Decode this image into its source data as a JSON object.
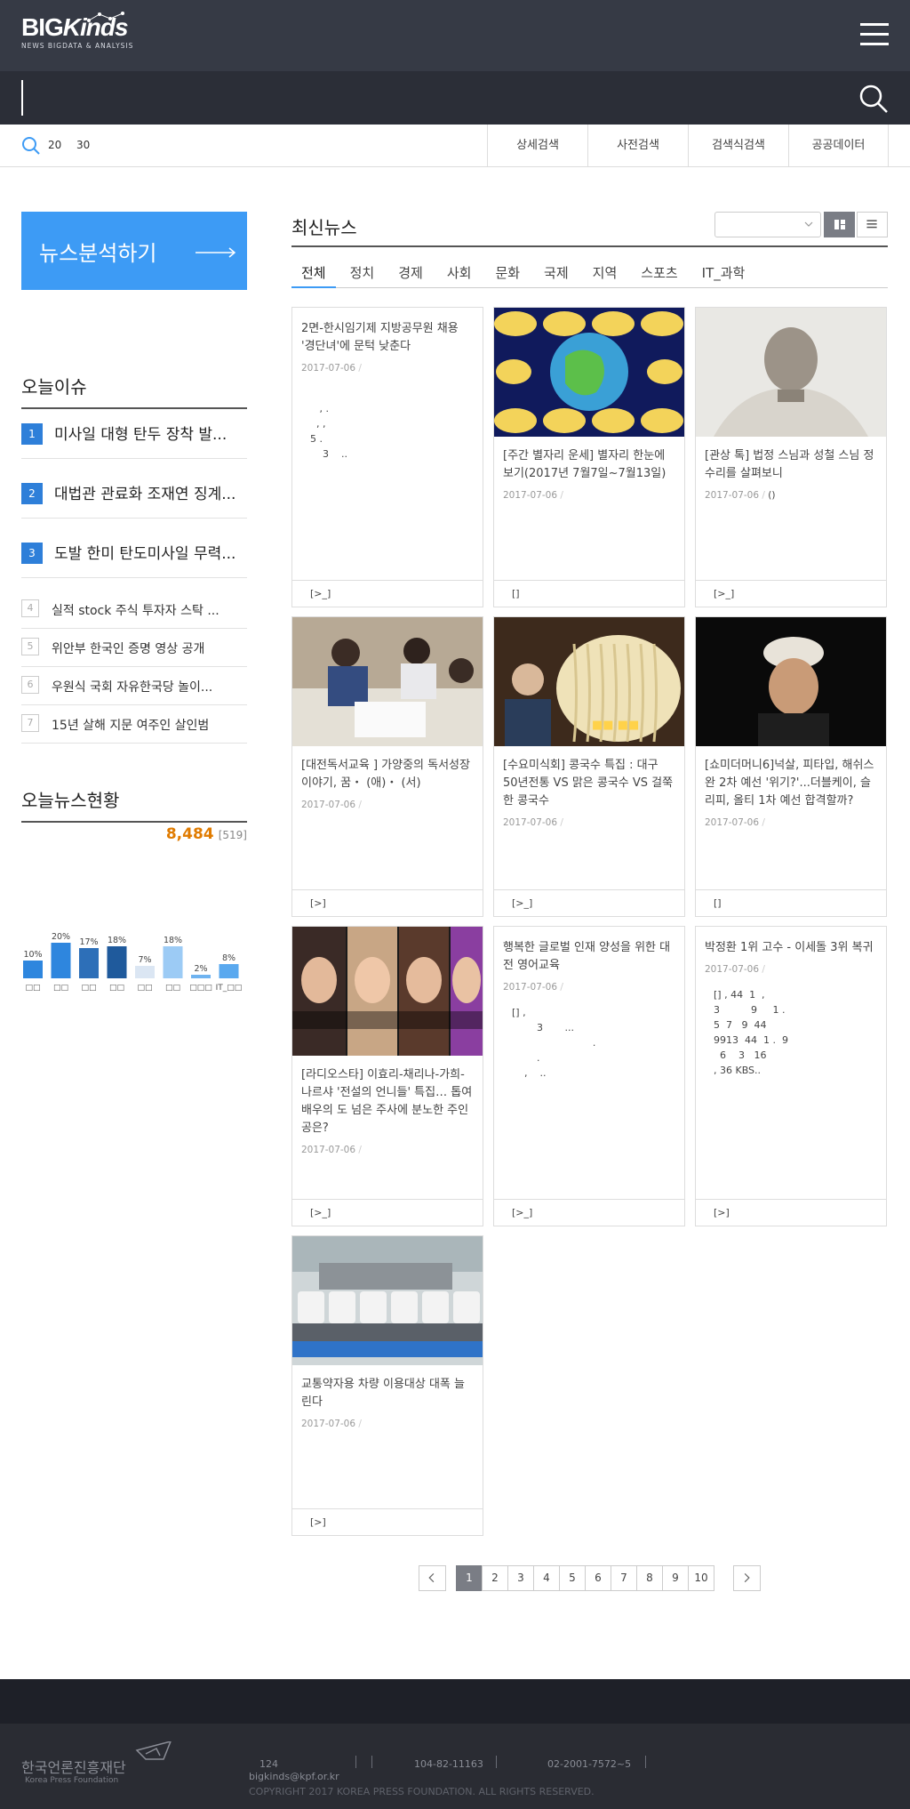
{
  "header": {
    "logo_big": "BIG",
    "logo_italic": "Kinds",
    "logo_sub": "NEWS BIGDATA & ANALYSIS",
    "menu_icon": "hamburger-icon"
  },
  "search": {
    "value": "",
    "placeholder": "",
    "icon": "search-icon"
  },
  "subnav": {
    "keyword1": "20",
    "keyword2": "30",
    "links": [
      "상세검색",
      "사전검색",
      "검색식검색",
      "공공데이터"
    ]
  },
  "sidebar": {
    "analyze_label": "뉴스분석하기",
    "issues_title": "오늘이슈",
    "issues_top": [
      {
        "num": "1",
        "text": "미사일 대형 탄두 장착 발..."
      },
      {
        "num": "2",
        "text": "대법관 관료화 조재연 징계..."
      },
      {
        "num": "3",
        "text": "도발 한미 탄도미사일 무력..."
      }
    ],
    "issues_rest": [
      {
        "num": "4",
        "text": "실적 stock 주식 투자자 스탁 ..."
      },
      {
        "num": "5",
        "text": "위안부 한국인 증명 영상 공개"
      },
      {
        "num": "6",
        "text": "우원식 국회 자유한국당 놀이..."
      },
      {
        "num": "7",
        "text": "15년 살해 지문 여주인 살인범"
      }
    ],
    "status_title": "오늘뉴스현황",
    "count_main": "8,484",
    "count_sub": "[519]"
  },
  "chart_data": {
    "type": "bar",
    "categories": [
      "",
      "",
      "",
      "",
      "",
      "",
      "",
      "IT_"
    ],
    "category_labels_shown": [
      "□□",
      "□□",
      "□□",
      "□□",
      "□□",
      "□□",
      "□□□",
      "IT_□□"
    ],
    "values": [
      10,
      20,
      17,
      18,
      7,
      18,
      2,
      8
    ],
    "value_labels": [
      "10%",
      "20%",
      "17%",
      "18%",
      "7%",
      "18%",
      "2%",
      "8%"
    ],
    "colors": [
      "#2e86de",
      "#2e86de",
      "#2d6fb8",
      "#1f5a9c",
      "#dbe6f3",
      "#9ccbf5",
      "#6fb3f0",
      "#5aa9ef"
    ],
    "ylim": [
      0,
      20
    ]
  },
  "news": {
    "title": "최신뉴스",
    "sort_value": "",
    "grid_icon": "grid-view-icon",
    "list_icon": "list-view-icon",
    "categories": [
      "전체",
      "정치",
      "경제",
      "사회",
      "문화",
      "국제",
      "지역",
      "스포츠",
      "IT_과학"
    ],
    "cards": [
      {
        "title": "2면-한시임기제 지방공무원 채용 '경단녀'에 문턱 낮춘다",
        "date": "2017-07-06",
        "body": "\n   , .\n  , ,\n5 .\n    3    ..",
        "foot": "[>_]",
        "img": ""
      },
      {
        "title": "[주간 별자리 운세] 별자리 한눈에 보기(2017년 7월7일~7월13일)",
        "date": "2017-07-06",
        "body": "",
        "foot": "[]",
        "img": "zodiac"
      },
      {
        "title": "[관상 톡] 법정 스님과 성철 스님 정수리를 살펴보니",
        "date": "2017-07-06",
        "body": "",
        "date_extra": "()",
        "foot": "[>_]",
        "img": "monk"
      },
      {
        "title": "[대전독서교육 ] 가양중의 독서성장 이야기, 꿈・ (애)・ (서)",
        "date": "2017-07-06",
        "body": "",
        "foot": "[>]",
        "img": "class"
      },
      {
        "title": "[수요미식회] 콩국수 특집 : 대구 50년전통 VS 맑은 콩국수 VS 걸쭉한 콩국수",
        "date": "2017-07-06",
        "body": "",
        "foot": "[>_]",
        "img": "noodle"
      },
      {
        "title": "[쇼미더머니6]넉살, 피타입, 해쉬스완 2차 예선 '위기?'...더블케이, 슬리피, 올티 1차 예선 합격할까?",
        "date": "2017-07-06",
        "body": "",
        "foot": "[]",
        "img": "cap"
      },
      {
        "title": "[라디오스타] 이효리-채리나-가희-나르샤 '전설의 언니들' 특집… 톱여배우의 도 넘은 주사에 분노한 주인공은?",
        "date": "2017-07-06",
        "body": "",
        "foot": "[>_]",
        "img": "women"
      },
      {
        "title": "행복한 글로벌 인재 양성을 위한 대전 영어교육",
        "date": "2017-07-06",
        "body": "[] ,\n        3       ...\n                          .\n        .\n    ,    ..",
        "foot": "[>_]",
        "img": ""
      },
      {
        "title": "박정환 1위 고수 - 이세돌 3위 복귀",
        "date": "2017-07-06",
        "body": "[] , 44  1  ,\n3          9     1 .\n5  7   9  44\n9913  44  1 .  9\n  6    3   16\n, 36 KBS..",
        "foot": "[>]",
        "img": ""
      },
      {
        "title": "교통약자용 차량 이용대상 대폭 늘린다",
        "date": "2017-07-06",
        "body": "",
        "foot": "[>]",
        "img": "vans"
      }
    ]
  },
  "pagination": {
    "pages": [
      "1",
      "2",
      "3",
      "4",
      "5",
      "6",
      "7",
      "8",
      "9",
      "10"
    ],
    "current": "1"
  },
  "footer": {
    "org": "한국언론진흥재단",
    "org_en": "Korea Press Foundation",
    "addr": "124",
    "bizno": "104-82-11163",
    "tel": "02-2001-7572~5",
    "email": "bigkinds@kpf.or.kr",
    "copyright": "COPYRIGHT 2017 KOREA PRESS FOUNDATION. ALL RIGHTS RESERVED."
  }
}
